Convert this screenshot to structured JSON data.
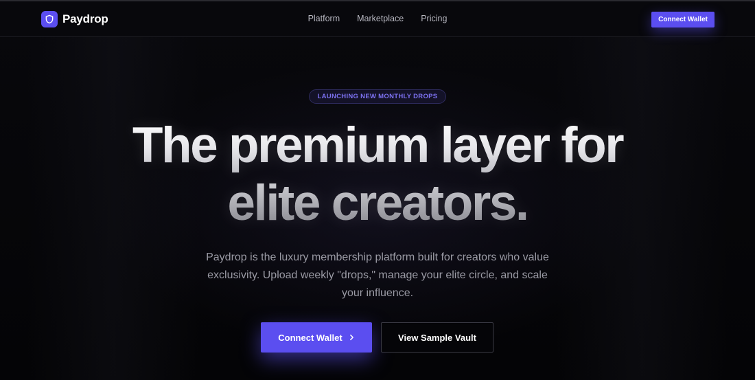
{
  "nav": {
    "brand": "Paydrop",
    "links": [
      "Platform",
      "Marketplace",
      "Pricing"
    ],
    "cta": "Connect Wallet"
  },
  "hero": {
    "badge": "LAUNCHING NEW MONTHLY DROPS",
    "headline_line1": "The premium layer for",
    "headline_line2": "elite creators.",
    "subtitle": "Paydrop is the luxury membership platform built for creators who value exclusivity. Upload weekly \"drops,\" manage your elite circle, and scale your influence.",
    "primary_button": "Connect Wallet",
    "secondary_button": "View Sample Vault"
  },
  "icons": {
    "brand_logo": "shield-icon",
    "primary_button_icon": "chevron-right-icon"
  },
  "colors": {
    "accent": "#5b4ef0",
    "background": "#050508",
    "badge_text": "#7d72f2"
  }
}
